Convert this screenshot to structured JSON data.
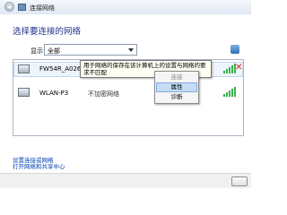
{
  "window": {
    "title": "连接网络"
  },
  "heading": "选择要连接的网络",
  "filter": {
    "label": "显示",
    "value": "全部"
  },
  "networks": [
    {
      "name": "FW54R_A02623",
      "status": ""
    },
    {
      "name": "WLAN-P3",
      "status": "不加密网络"
    }
  ],
  "tooltip": "用于网络的保存在该计算机上的设置与网络的要求不匹配",
  "context_menu": {
    "items": [
      "连接",
      "属性",
      "诊断"
    ]
  },
  "links": [
    "设置连接或网络",
    "打开网络和共享中心"
  ],
  "colors": {
    "link": "#0645ad",
    "heading": "#1e3287",
    "signal": "#3bb34a",
    "remove": "#d3261d"
  },
  "icons": {
    "back": "back-arrow-icon",
    "window": "network-icon",
    "refresh": "refresh-icon",
    "network": "computer-network-icon",
    "remove": "red-x-icon",
    "signal": "signal-strength-icon"
  }
}
